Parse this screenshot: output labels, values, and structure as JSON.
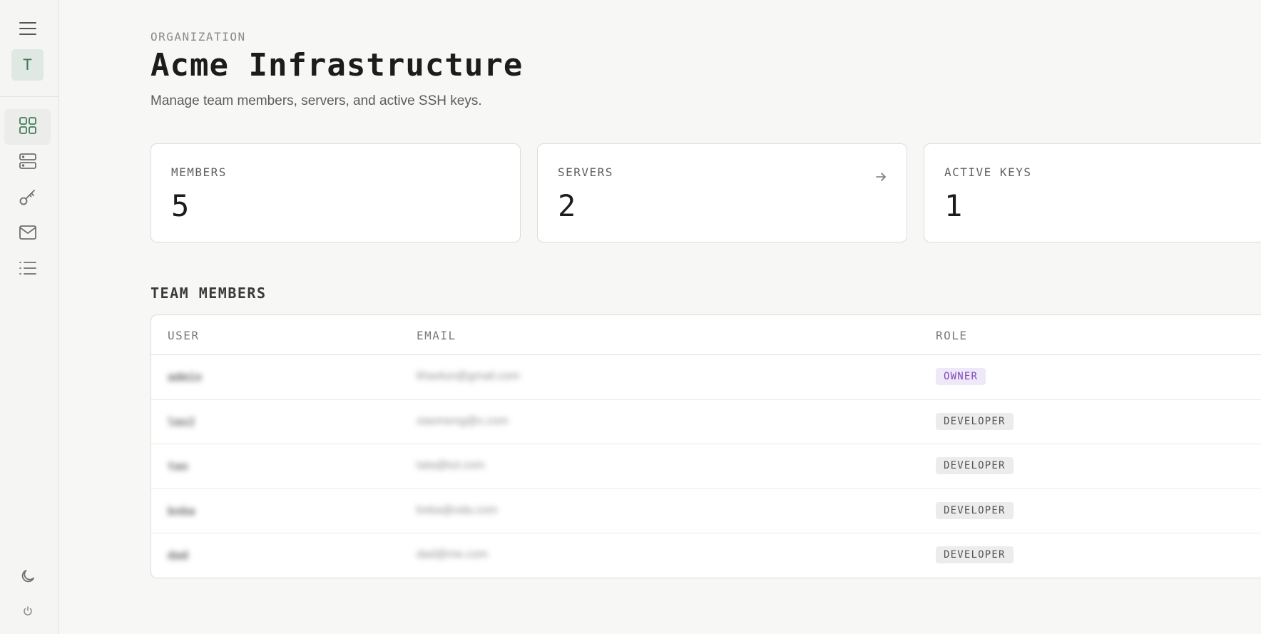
{
  "sidebar": {
    "avatar_letter": "T",
    "icons": [
      "menu-icon",
      "dashboard-icon",
      "server-icon",
      "key-icon",
      "mail-icon",
      "list-icon",
      "moon-icon",
      "power-icon"
    ],
    "accent_color": "#3f7d5a"
  },
  "header": {
    "eyebrow": "ORGANIZATION",
    "title": "Acme Infrastructure",
    "subtitle": "Manage team members, servers, and active SSH keys."
  },
  "stats": [
    {
      "label": "MEMBERS",
      "value": "5",
      "has_arrow": false
    },
    {
      "label": "SERVERS",
      "value": "2",
      "has_arrow": true
    },
    {
      "label": "ACTIVE KEYS",
      "value": "1",
      "has_arrow": true
    }
  ],
  "team": {
    "title": "TEAM MEMBERS",
    "columns": {
      "user": "USER",
      "email": "EMAIL",
      "role": "ROLE"
    },
    "rows": [
      {
        "user": "admin",
        "email": "lihaolun@gmail.com",
        "role": "OWNER"
      },
      {
        "user": "lmx2",
        "email": "xiaomeng@x.com",
        "role": "DEVELOPER"
      },
      {
        "user": "tao",
        "email": "tata@tut.com",
        "role": "DEVELOPER"
      },
      {
        "user": "boba",
        "email": "boba@oda.com",
        "role": "DEVELOPER"
      },
      {
        "user": "dad",
        "email": "dad@me.com",
        "role": "DEVELOPER"
      }
    ]
  },
  "colors": {
    "owner_badge_bg": "#efe8f8",
    "owner_badge_text": "#7a4cbb",
    "developer_badge_bg": "#ececec"
  }
}
